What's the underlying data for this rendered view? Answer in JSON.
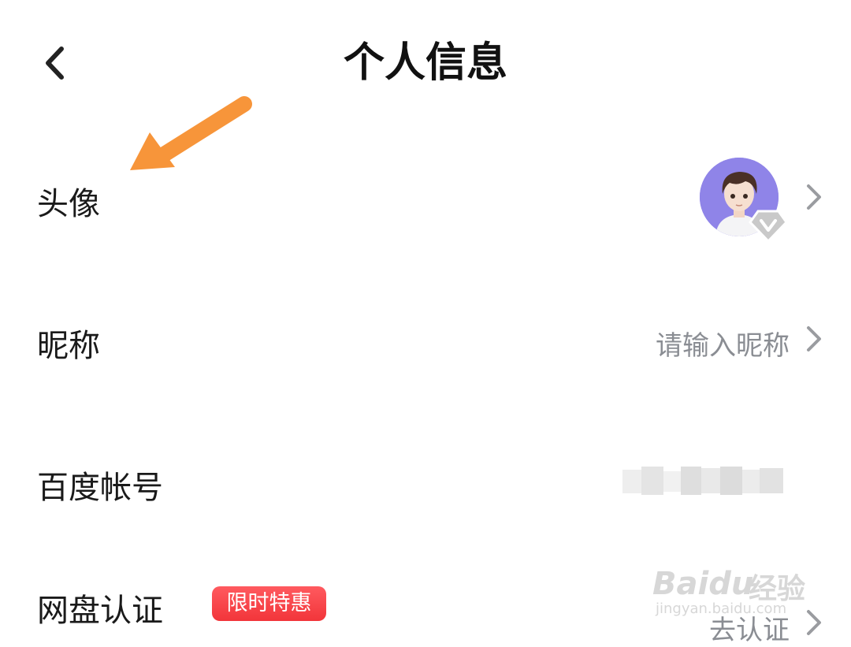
{
  "header": {
    "title": "个人信息",
    "back_icon": "chevron-left-icon"
  },
  "rows": [
    {
      "label": "头像",
      "value": "",
      "type": "avatar"
    },
    {
      "label": "昵称",
      "value": "请输入昵称"
    },
    {
      "label": "百度帐号",
      "value": ""
    },
    {
      "label": "网盘认证",
      "badge": "限时特惠",
      "value": "去认证"
    }
  ],
  "annotation": {
    "icon": "orange-arrow-icon",
    "color": "#f7953a"
  },
  "avatar": {
    "bg_color": "#8f84e8",
    "vip_icon": "vip-diamond-icon"
  },
  "watermark": {
    "brand": "Baidu",
    "brand_cn": "经验",
    "url": "jingyan.baidu.com"
  },
  "colors": {
    "value_text": "#8a8d93",
    "badge": "#f2353a",
    "chevron": "#9a9ca0"
  }
}
